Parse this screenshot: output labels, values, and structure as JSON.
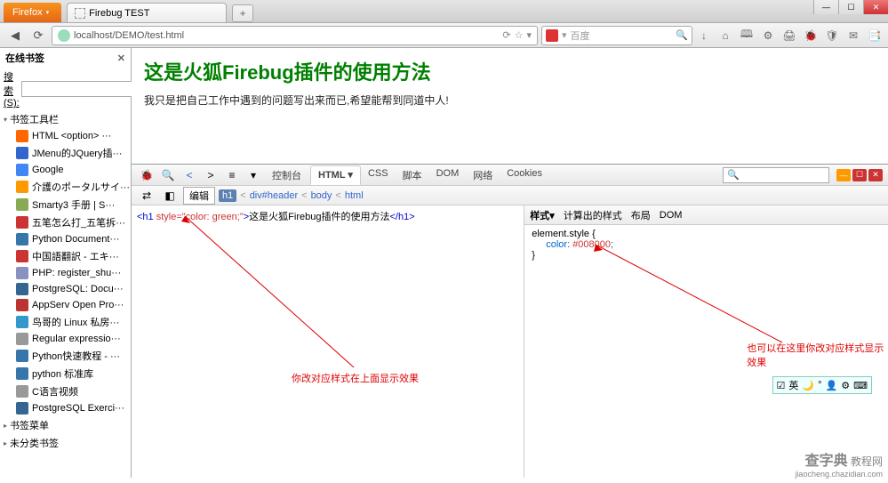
{
  "window": {
    "min": "—",
    "max": "☐",
    "close": "✕"
  },
  "firefox_btn": {
    "label": "Firefox",
    "tri": "▾"
  },
  "tab": {
    "title": "Firebug TEST"
  },
  "newtab": "+",
  "nav": {
    "back": "◀",
    "reload": "⟳"
  },
  "url": "localhost/DEMO/test.html",
  "urlbar_icons": {
    "reload": "⟳",
    "star": "☆",
    "drop": "▾"
  },
  "searchbox": {
    "placeholder": "百度",
    "drop": "▾",
    "mag": "🔍"
  },
  "toolbar_icons": [
    "↓",
    "⌂",
    "🕮",
    "⚙",
    "🖨",
    "🐞",
    "🛡",
    "✉",
    "📑"
  ],
  "sidebar": {
    "title": "在线书签",
    "close": "✕",
    "search_label": "搜索(S):",
    "folders": {
      "toolbar": "书签工具栏",
      "menu": "书签菜单",
      "unsorted": "未分类书签"
    },
    "items": [
      {
        "label": "HTML <option> ···",
        "color": "#f60"
      },
      {
        "label": "JMenu的JQuery插···",
        "color": "#36c"
      },
      {
        "label": "Google",
        "color": "#4285f4"
      },
      {
        "label": "介護のポータルサイ···",
        "color": "#f90"
      },
      {
        "label": "Smarty3 手册 | S···",
        "color": "#8a5"
      },
      {
        "label": "五笔怎么打_五笔拆···",
        "color": "#c33"
      },
      {
        "label": "Python Document···",
        "color": "#3776ab"
      },
      {
        "label": "中国語翻訳 - エキ···",
        "color": "#c33"
      },
      {
        "label": "PHP: register_shu···",
        "color": "#8892bf"
      },
      {
        "label": "PostgreSQL: Docu···",
        "color": "#336791"
      },
      {
        "label": "AppServ Open Pro···",
        "color": "#b33"
      },
      {
        "label": "鸟哥的 Linux 私房···",
        "color": "#39c"
      },
      {
        "label": "Regular expressio···",
        "color": "#999"
      },
      {
        "label": "Python快速教程 - ···",
        "color": "#3776ab"
      },
      {
        "label": "python 标准库",
        "color": "#3776ab"
      },
      {
        "label": "C语言视频",
        "color": "#999"
      },
      {
        "label": "PostgreSQL Exerci···",
        "color": "#336791"
      }
    ]
  },
  "page": {
    "h1": "这是火狐Firebug插件的使用方法",
    "p": "我只是把自己工作中遇到的问题写出来而已,希望能帮到同道中人!"
  },
  "firebug": {
    "toolbar": {
      "bug": "🐞",
      "inspect": "🔍",
      "nav_l": "<",
      "nav_r": ">",
      "menu": "≡",
      "console_drop": "▾",
      "console": "控制台",
      "tabs": [
        "HTML",
        "CSS",
        "脚本",
        "DOM",
        "网络",
        "Cookies"
      ],
      "search_icon": "🔍"
    },
    "win_btns": {
      "min": "—",
      "det": "☐",
      "close": "✕"
    },
    "subbar": {
      "toggle1": "⇄",
      "toggle2": "◧",
      "edit": "编辑",
      "breadcrumb": [
        "h1",
        "div#header",
        "body",
        "html"
      ]
    },
    "html_code": {
      "open": "<h1 ",
      "attr": "style=",
      "val": "\"color: green;\"",
      "close1": ">",
      "text": "这是火狐Firebug插件的使用方法",
      "close2": "</h1>"
    },
    "side": {
      "tabs": [
        "样式",
        "计算出的样式",
        "布局",
        "DOM"
      ],
      "drop": "▾",
      "css": {
        "selector": "element.style {",
        "prop": "color",
        "value": "#008000",
        "end": "}"
      }
    }
  },
  "annotations": {
    "left": "你改对应样式在上面显示效果",
    "right": "也可以在这里你改对应样式显示效果"
  },
  "ime": {
    "icons": [
      "☑",
      "英",
      "🌙",
      "°",
      "👤",
      "⚙",
      "⌨"
    ]
  },
  "watermark": {
    "l1": "查字典",
    "l2": "jiaocheng.chazidian.com",
    "suffix": "教程网"
  }
}
